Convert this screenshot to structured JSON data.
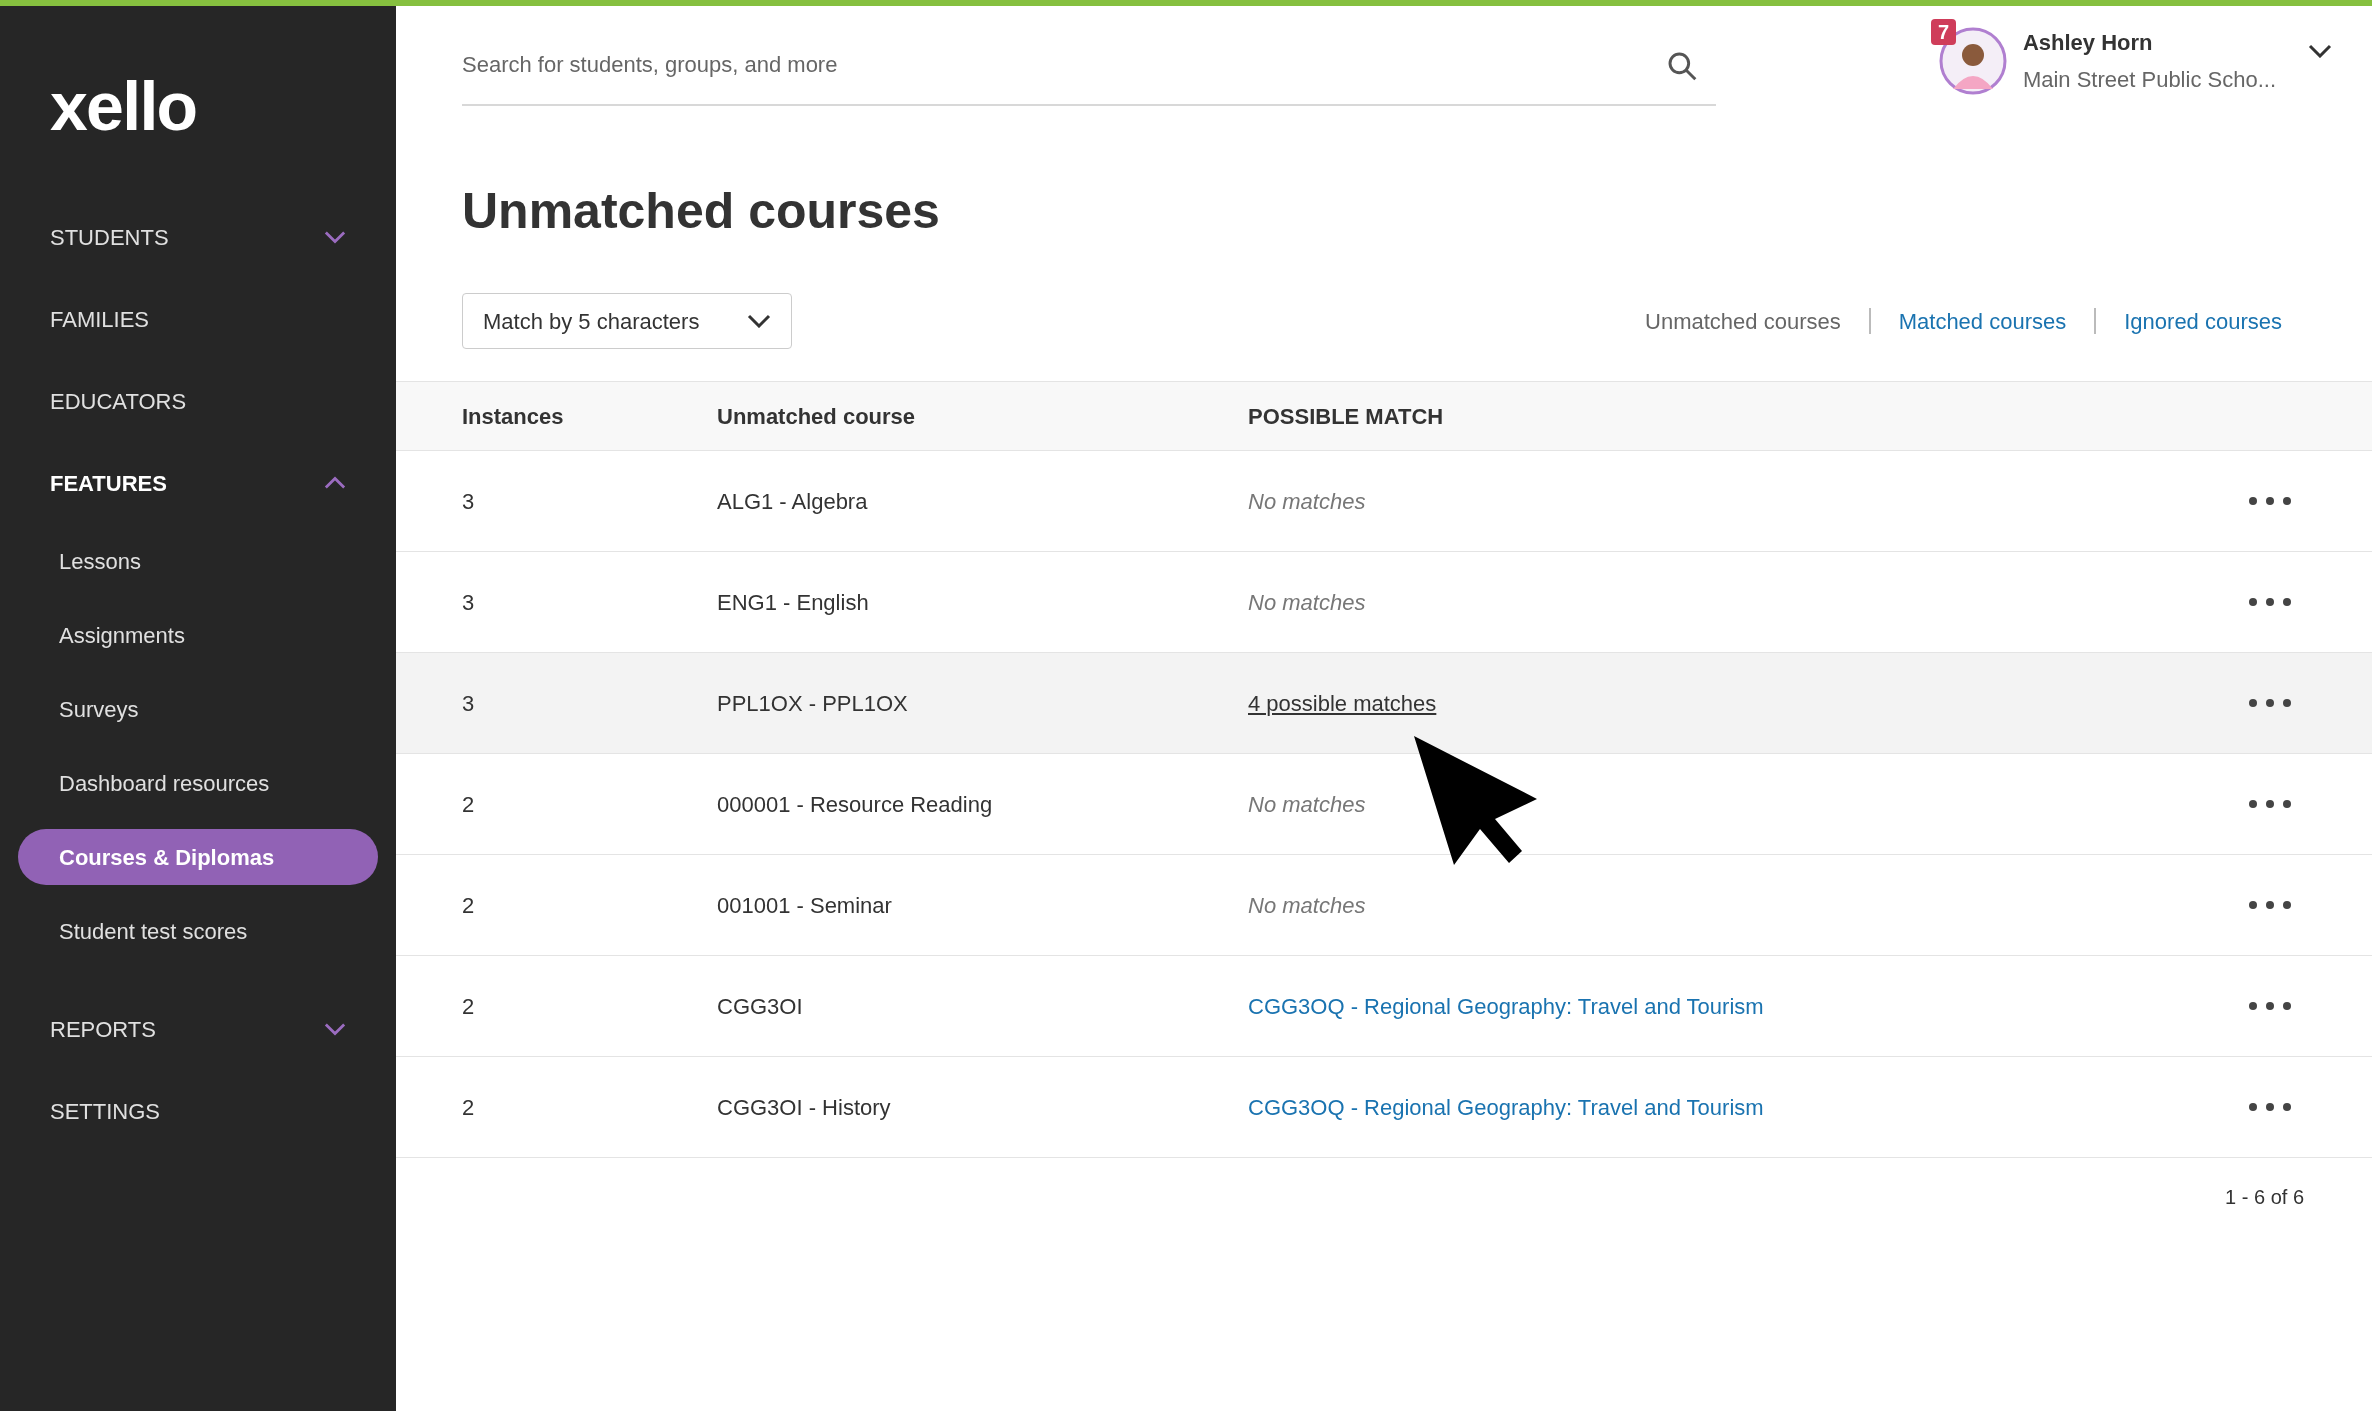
{
  "logo": {
    "text": "xello"
  },
  "sidebar": {
    "items": [
      {
        "label": "STUDENTS",
        "expanded": false
      },
      {
        "label": "FAMILIES"
      },
      {
        "label": "EDUCATORS"
      },
      {
        "label": "FEATURES",
        "expanded": true,
        "children": [
          {
            "label": "Lessons",
            "selected": false
          },
          {
            "label": "Assignments",
            "selected": false
          },
          {
            "label": "Surveys",
            "selected": false
          },
          {
            "label": "Dashboard resources",
            "selected": false
          },
          {
            "label": "Courses & Diplomas",
            "selected": true
          },
          {
            "label": "Student test scores",
            "selected": false
          }
        ]
      },
      {
        "label": "REPORTS",
        "expanded": false
      },
      {
        "label": "SETTINGS"
      }
    ]
  },
  "search": {
    "placeholder": "Search for students, groups, and more"
  },
  "user": {
    "name": "Ashley Horn",
    "school": "Main Street Public Scho...",
    "notifications": "7"
  },
  "page_title": "Unmatched courses",
  "match_dropdown": {
    "value": "Match by 5 characters"
  },
  "view_tabs": [
    {
      "label": "Unmatched courses",
      "selected": true
    },
    {
      "label": "Matched courses",
      "selected": false
    },
    {
      "label": "Ignored courses",
      "selected": false
    }
  ],
  "table": {
    "columns": [
      "Instances",
      "Unmatched course",
      "POSSIBLE MATCH"
    ],
    "rows": [
      {
        "instances": "3",
        "course": "ALG1 - Algebra",
        "match": "No matches",
        "kind": "none",
        "hovered": false
      },
      {
        "instances": "3",
        "course": "ENG1 - English",
        "match": "No matches",
        "kind": "none",
        "hovered": false
      },
      {
        "instances": "3",
        "course": "PPL1OX - PPL1OX",
        "match": "4 possible matches",
        "kind": "possible",
        "hovered": true
      },
      {
        "instances": "2",
        "course": "000001 - Resource Reading",
        "match": "No matches",
        "kind": "none",
        "hovered": false
      },
      {
        "instances": "2",
        "course": "001001 - Seminar",
        "match": "No matches",
        "kind": "none",
        "hovered": false
      },
      {
        "instances": "2",
        "course": "CGG3OI",
        "match": "CGG3OQ - Regional Geography: Travel and Tourism",
        "kind": "match",
        "hovered": false
      },
      {
        "instances": "2",
        "course": "CGG3OI - History",
        "match": "CGG3OQ - Regional Geography: Travel and Tourism",
        "kind": "match",
        "hovered": false
      }
    ]
  },
  "pagination": "1 - 6 of 6"
}
